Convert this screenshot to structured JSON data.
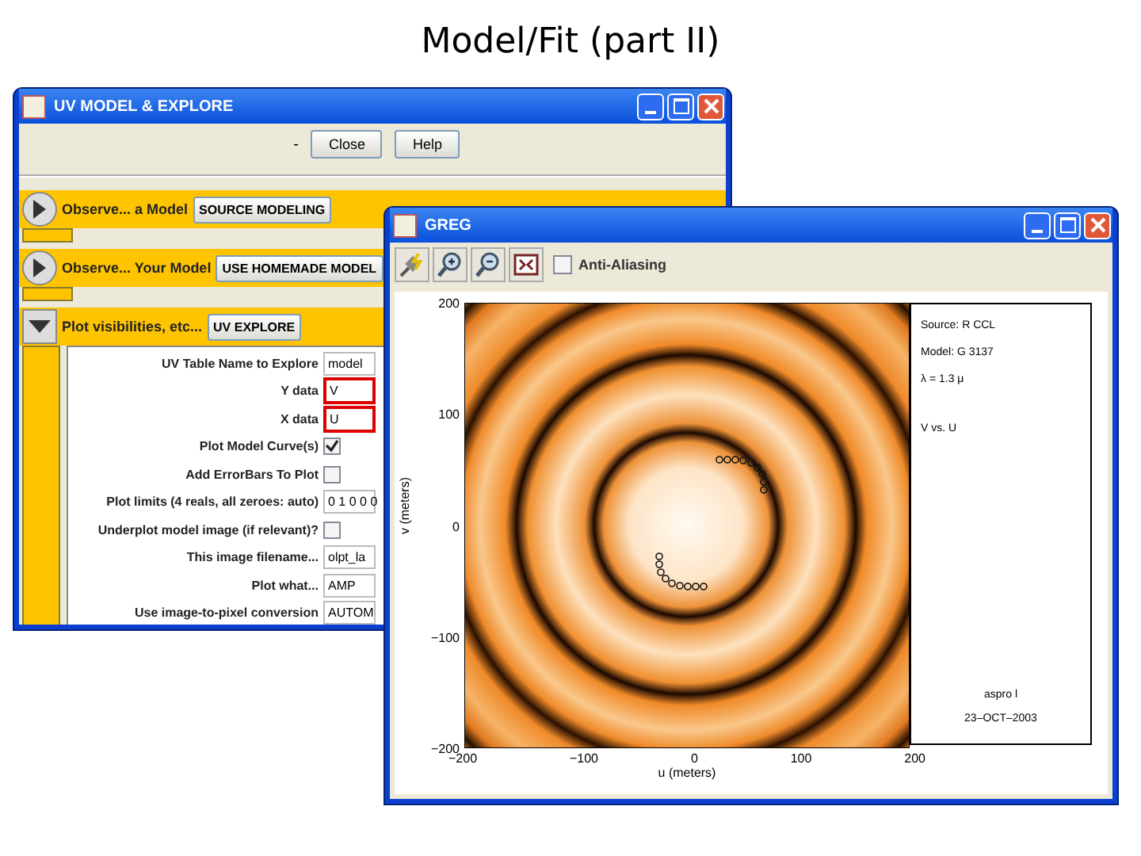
{
  "slide_title": "Model/Fit (part II)",
  "uv_window": {
    "title": "UV MODEL & EXPLORE",
    "toolbar": {
      "separator": "-",
      "buttons": [
        "Close",
        "Help"
      ]
    },
    "sections": [
      {
        "label": "Observe... a Model",
        "button": "SOURCE MODELING",
        "expanded": false
      },
      {
        "label": "Observe... Your Model",
        "button": "USE HOMEMADE MODEL",
        "expanded": false
      },
      {
        "label": "Plot visibilities, etc...",
        "button": "UV EXPLORE",
        "expanded": true
      }
    ],
    "form": [
      {
        "kind": "text",
        "label": "UV Table Name to Explore",
        "value": "model",
        "highlighted": false
      },
      {
        "kind": "text",
        "label": "Y data",
        "value": "V",
        "highlighted": true
      },
      {
        "kind": "text",
        "label": "X data",
        "value": "U",
        "highlighted": true
      },
      {
        "kind": "checkbox",
        "label": "Plot Model Curve(s)",
        "checked": true
      },
      {
        "kind": "checkbox",
        "label": "Add ErrorBars To Plot",
        "checked": false
      },
      {
        "kind": "text",
        "label": "Plot limits (4 reals, all zeroes: auto)",
        "value": "0 1 0 0 0",
        "highlighted": false
      },
      {
        "kind": "checkbox",
        "label": "Underplot model image (if relevant)?",
        "checked": false
      },
      {
        "kind": "text",
        "label": "This image filename...",
        "value": "olpt_la",
        "highlighted": false
      },
      {
        "kind": "text",
        "label": "Plot what...",
        "value": "AMP",
        "highlighted": false
      },
      {
        "kind": "text",
        "label": "Use image-to-pixel conversion",
        "value": "AUTOM",
        "highlighted": false
      }
    ]
  },
  "greg_window": {
    "title": "GREG",
    "anti_aliasing": {
      "label": "Anti-Aliasing",
      "checked": false
    },
    "plot": {
      "x_ticks": [
        "−200",
        "−100",
        "0",
        "100",
        "200"
      ],
      "y_ticks": [
        "200",
        "100",
        "0",
        "−100",
        "−200"
      ],
      "xlabel": "u (meters)",
      "ylabel": "v (meters)"
    },
    "legend_top": [
      "Source: R CCL",
      "Model: G 3137",
      "λ = 1.3 μ",
      "V vs. U"
    ],
    "legend_bottom": [
      "aspro l",
      "23–OCT–2003"
    ]
  }
}
